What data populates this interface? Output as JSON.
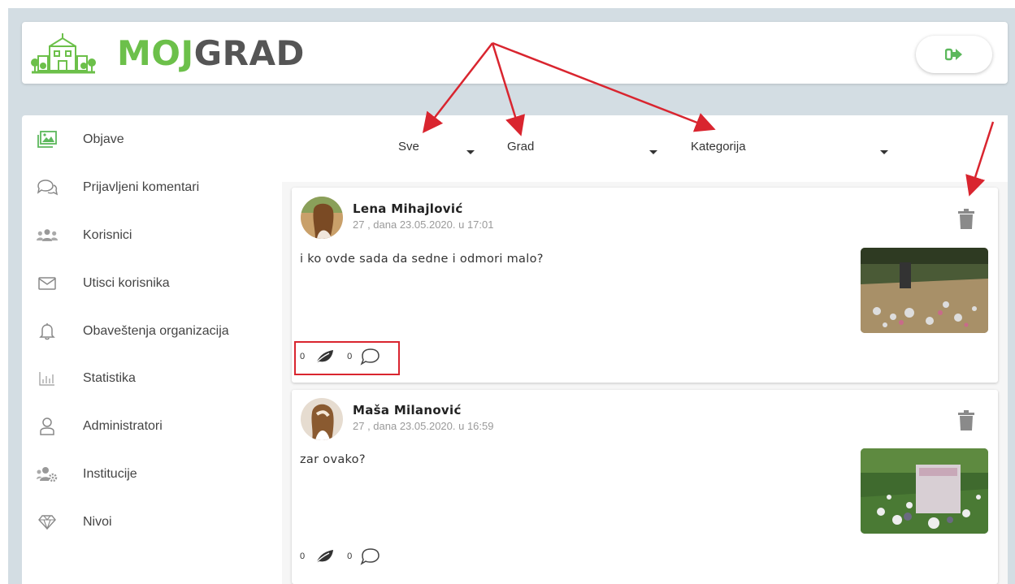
{
  "header": {
    "logo_text_part1": "MOJ",
    "logo_text_part2": "GRAD",
    "logout_icon": "sign-out-icon"
  },
  "sidebar": {
    "items": [
      {
        "label": "Objave",
        "icon": "images-icon",
        "color": "#5cb85c"
      },
      {
        "label": "Prijavljeni komentari",
        "icon": "comments-icon"
      },
      {
        "label": "Korisnici",
        "icon": "users-icon"
      },
      {
        "label": "Utisci korisnika",
        "icon": "envelope-icon"
      },
      {
        "label": "Obaveštenja organizacija",
        "icon": "bell-icon"
      },
      {
        "label": "Statistika",
        "icon": "bar-chart-icon"
      },
      {
        "label": "Administratori",
        "icon": "user-icon"
      },
      {
        "label": "Institucije",
        "icon": "users-cog-icon"
      },
      {
        "label": "Nivoi",
        "icon": "diamond-icon"
      }
    ]
  },
  "filters": {
    "status": "Sve",
    "city": "Grad",
    "category": "Kategorija"
  },
  "posts": [
    {
      "author": "Lena Mihajlović",
      "meta": "27 , dana 23.05.2020. u 17:01",
      "text": "i ko ovde sada da sedne i odmori malo?",
      "likes": "0",
      "comments": "0"
    },
    {
      "author": "Maša Milanović",
      "meta": "27 , dana 23.05.2020. u 16:59",
      "text": "zar ovako?",
      "likes": "0",
      "comments": "0"
    }
  ],
  "colors": {
    "brand_green": "#6cc04a",
    "annotation_red": "#d9252f",
    "background": "#d3dde3"
  }
}
